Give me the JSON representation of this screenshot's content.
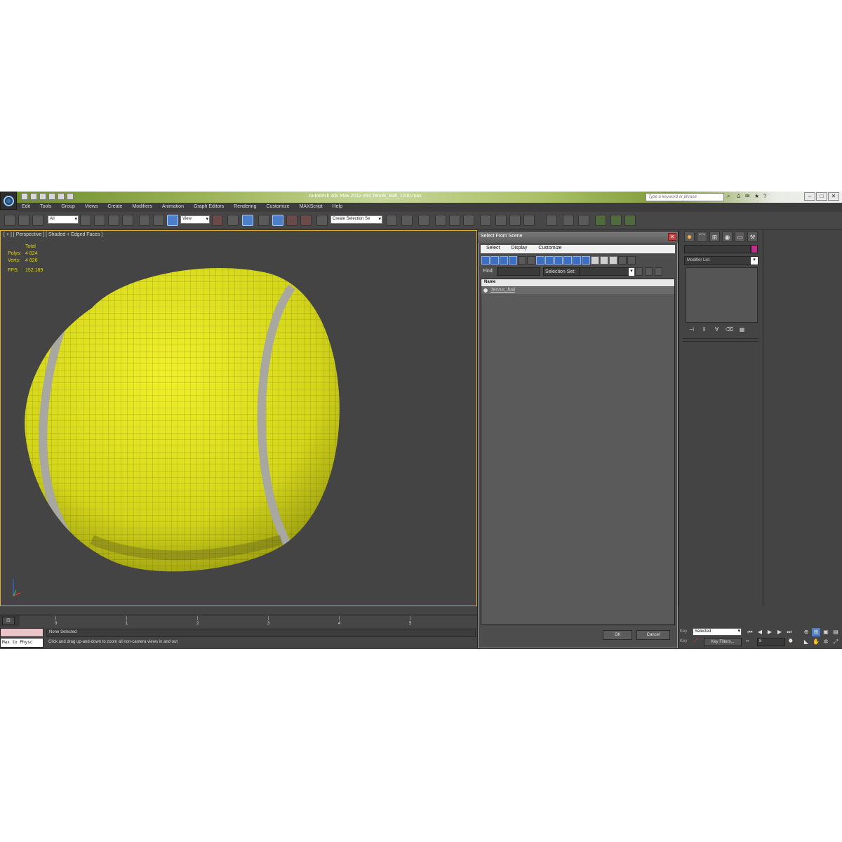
{
  "window": {
    "title": "Autodesk 3ds Max  2012 x64      Tennis_Ball_1200.max",
    "search_placeholder": "Type a keyword or phrase"
  },
  "menu": [
    "Edit",
    "Tools",
    "Group",
    "Views",
    "Create",
    "Modifiers",
    "Animation",
    "Graph Editors",
    "Rendering",
    "Customize",
    "MAXScript",
    "Help"
  ],
  "toolbar": {
    "selection_filter": "All",
    "reference_coord": "View",
    "named_selection": "Create Selection Se"
  },
  "viewport": {
    "label": "[ + ] [ Perspective ] [ Shaded + Edged Faces ]",
    "stats": {
      "total_label": "Total",
      "polys_label": "Polys:",
      "polys_value": "4 824",
      "verts_label": "Verts:",
      "verts_value": "4 826",
      "fps_label": "FPS:",
      "fps_value": "152,189"
    },
    "object_color": "#d9dd1c"
  },
  "dialog": {
    "title": "Select From Scene",
    "menu": [
      "Select",
      "Display",
      "Customize"
    ],
    "find_label": "Find:",
    "selection_set_label": "Selection Set:",
    "column_name": "Name",
    "items": [
      "Tennis_ball"
    ],
    "ok_label": "OK",
    "cancel_label": "Cancel"
  },
  "command_panel": {
    "modifier_list": "Modifier List",
    "object_color": "#c02c8a"
  },
  "timeline": {
    "ticks": [
      "0",
      "1",
      "2",
      "3",
      "4",
      "5"
    ]
  },
  "status": {
    "maxscript": "Max to Physc",
    "selection": "None Selected",
    "prompt": "Click and drag up-and-down to zoom all non-camera views in and out"
  },
  "anim": {
    "key_mode_label": "Key",
    "set_key_label": "Key",
    "selected_value": "Selected",
    "key_filters_label": "Key Filters...",
    "frame_value": "8"
  }
}
